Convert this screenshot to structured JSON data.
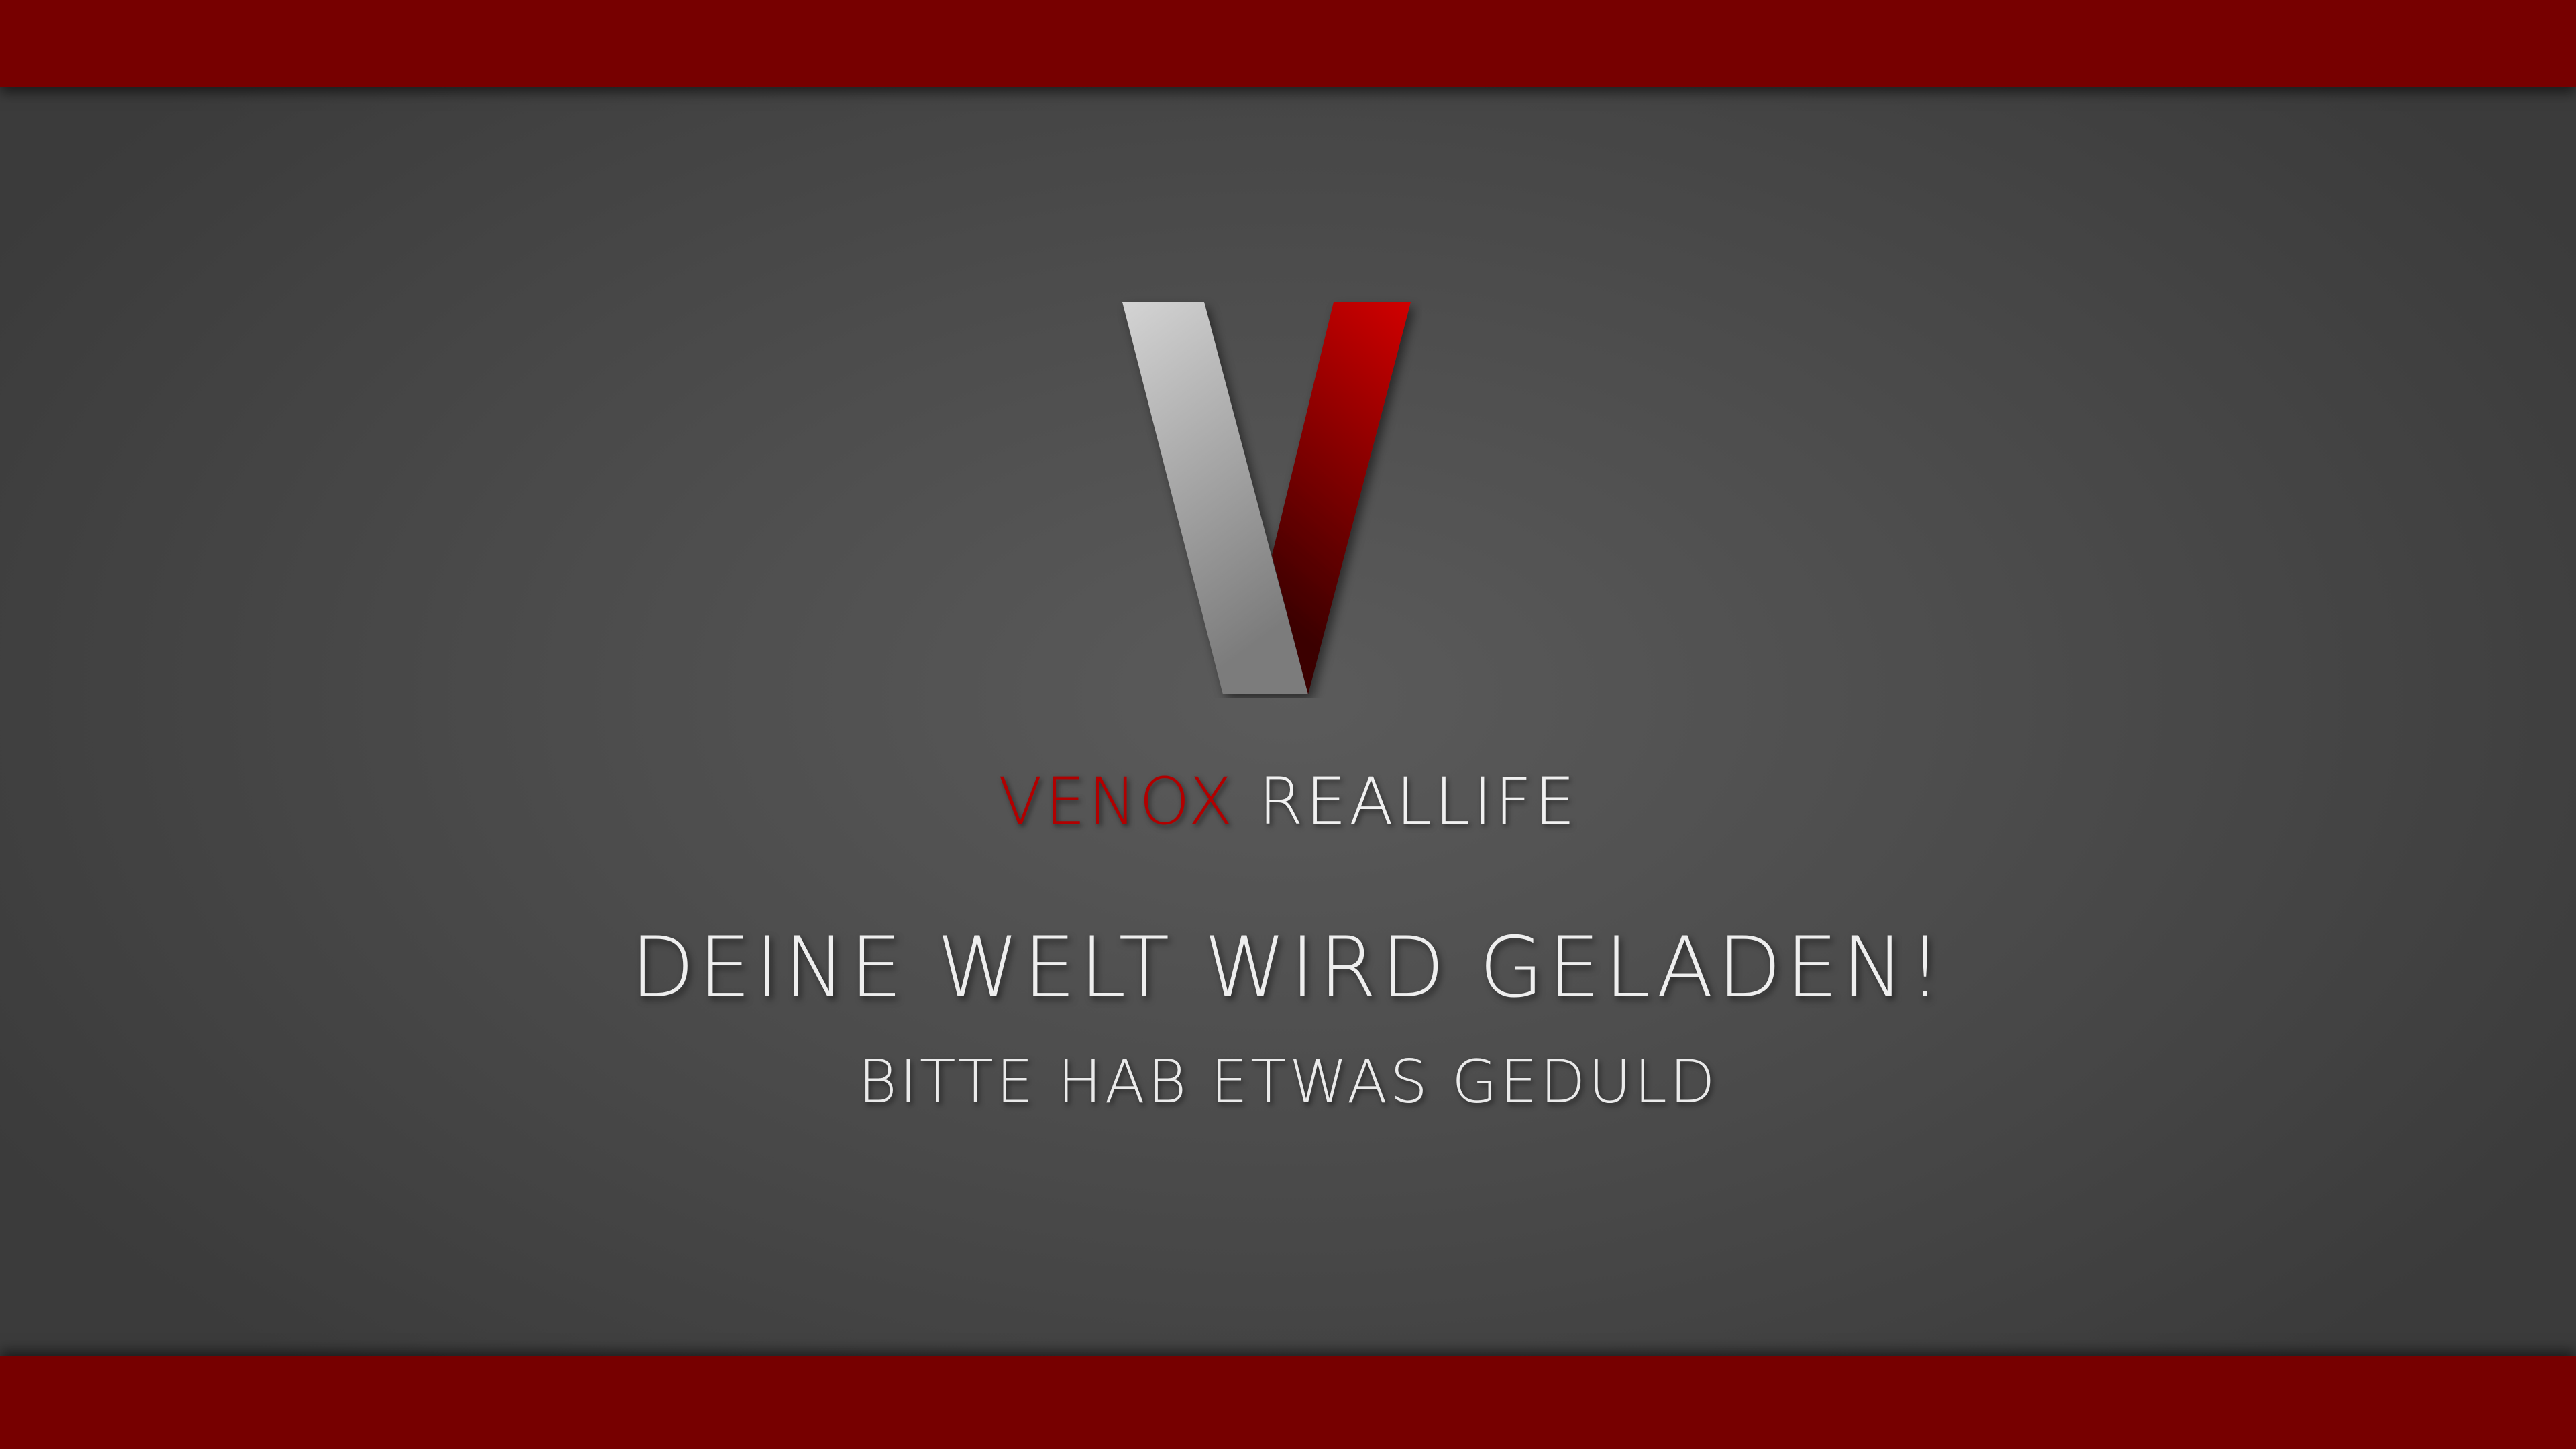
{
  "loading_screen": {
    "brand_first": "VENOX",
    "brand_second": "REALLIFE",
    "headline": "DEINE WELT WIRD GELADEN!",
    "subline": "BITTE HAB ETWAS GEDULD",
    "logo_icon": "venox-v-logo-icon"
  },
  "colors": {
    "bar": "#770000",
    "accent_red": "#b10000",
    "text": "#eeeeee",
    "background": "#4d4d4d"
  }
}
